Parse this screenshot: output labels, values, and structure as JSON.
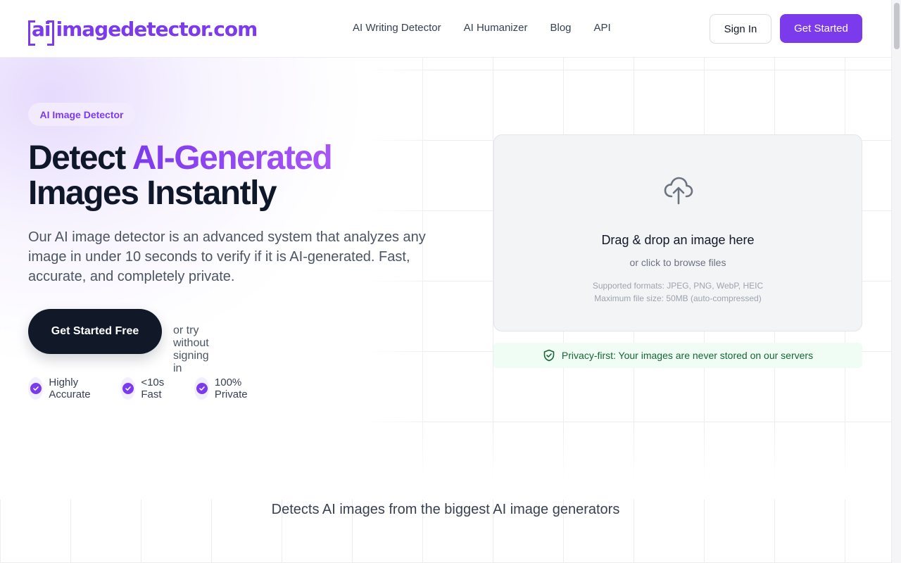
{
  "header": {
    "logo_prefix": "ai",
    "logo_text": "imagedetector.com",
    "nav": [
      {
        "label": "AI Writing Detector"
      },
      {
        "label": "AI Humanizer"
      },
      {
        "label": "Blog"
      },
      {
        "label": "API"
      }
    ],
    "signin_label": "Sign In",
    "get_started_label": "Get Started"
  },
  "hero": {
    "badge": "AI Image Detector",
    "headline_part1": "Detect ",
    "headline_accent": "AI-Generated",
    "headline_part2": "Images Instantly",
    "subtext": "Our AI image detector is an advanced system that analyzes any image in under 10 seconds to verify if it is AI-generated. Fast, accurate, and completely private.",
    "cta_label": "Get Started Free",
    "try_label": "or try without signing in",
    "features": [
      {
        "label": "Highly Accurate"
      },
      {
        "label": "<10s Fast"
      },
      {
        "label": "100% Private"
      }
    ]
  },
  "upload": {
    "icon": "cloud-upload-icon",
    "title": "Drag & drop an image here",
    "subtitle": "or click to browse files",
    "formats": "Supported formats: JPEG, PNG, WebP, HEIC",
    "max_size": "Maximum file size: 50MB (auto-compressed)"
  },
  "privacy": {
    "icon": "shield-check-icon",
    "text": "Privacy-first: Your images are never stored on our servers"
  },
  "generators_heading": "Detects AI images from the biggest AI image generators",
  "colors": {
    "brand": "#7c3aed",
    "dark": "#111827",
    "privacy_bg": "#f0fdf4",
    "privacy_text": "#166534"
  }
}
